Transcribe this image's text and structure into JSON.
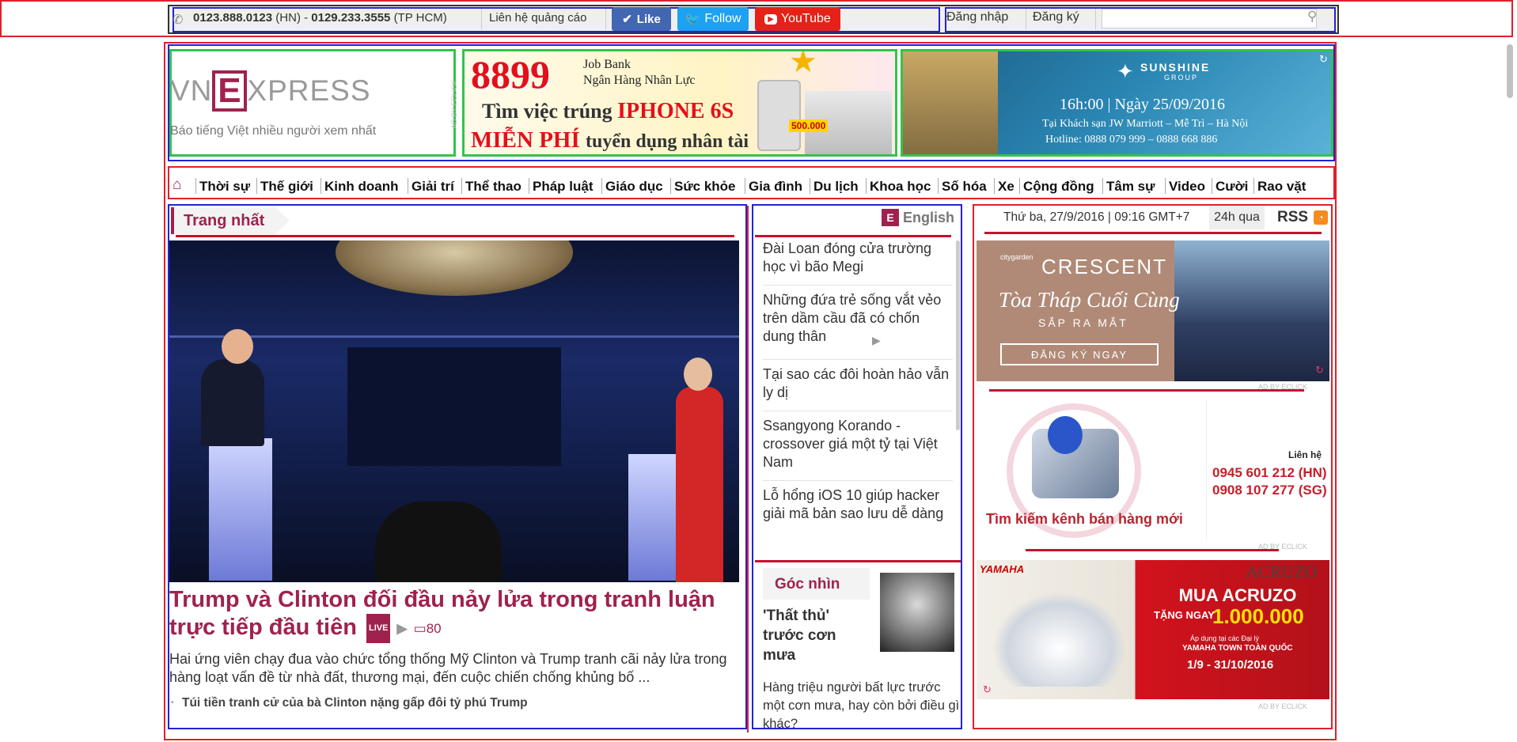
{
  "topbar": {
    "phone_hn": "0123.888.0123",
    "hn_label": "(HN) -",
    "phone_hcm": "0129.233.3555",
    "hcm_label": "(TP HCM)",
    "ads_contact": "Liên hệ quảng cáo",
    "like_label": "Like",
    "follow_label": "Follow",
    "youtube_label": "YouTube",
    "login": "Đăng nhập",
    "register": "Đăng ký",
    "search_placeholder": ""
  },
  "header": {
    "logo_vn": "VN",
    "logo_e": "E",
    "logo_xpress": "XPRESS",
    "tagline": "Báo tiếng Việt nhiều người xem nhất",
    "ad_label": "AD BY ECLICK",
    "ad_job": {
      "number": "8899",
      "brand1": "Job Bank",
      "brand2": "Ngân Hàng Nhân Lực",
      "line1a": "Tìm việc trúng",
      "line1b": "IPHONE 6S",
      "line2a": "MIỄN PHÍ",
      "line2b": "tuyển dụng nhân tài",
      "price": "500.000"
    },
    "ad_sun": {
      "brand": "SUNSHINE",
      "group": "GROUP",
      "time": "16h:00 | Ngày 25/09/2016",
      "place": "Tại Khách sạn JW Marriott – Mễ Trì – Hà Nội",
      "hotline": "Hotline: 0888 079 999 – 0888 668 886"
    }
  },
  "nav": [
    "Thời sự",
    "Thế giới",
    "Kinh doanh",
    "Giải trí",
    "Thể thao",
    "Pháp luật",
    "Giáo dục",
    "Sức khỏe",
    "Gia đình",
    "Du lịch",
    "Khoa học",
    "Số hóa",
    "Xe",
    "Cộng đồng",
    "Tâm sự",
    "Video",
    "Cười",
    "Rao vặt"
  ],
  "main": {
    "section_title": "Trang nhất",
    "headline": "Trump và Clinton đối đầu nảy lửa trong tranh luận trực tiếp đầu tiên",
    "live_badge": "LIVE",
    "comment_count": "80",
    "lead": "Hai ứng viên chạy đua vào chức tổng thống Mỹ Clinton và Trump tranh cãi nảy lửa trong hàng loạt vấn đề từ nhà đất, thương mại, đến cuộc chiến chống khủng bố ...",
    "related": "Túi tiền tranh cử của bà Clinton nặng gấp đôi tỷ phú Trump"
  },
  "mid": {
    "english_label": "English",
    "articles": [
      "Đài Loan đóng cửa trường học vì bão Megi",
      "Những đứa trẻ sống vắt vẻo trên dầm cầu đã có chốn dung thân",
      "Tại sao các đôi hoàn hảo vẫn ly dị",
      "Ssangyong Korando - crossover giá một tỷ tại Việt Nam",
      "Lỗ hổng iOS 10 giúp hacker giải mã bản sao lưu dễ dàng"
    ],
    "gocnhin_title": "Góc nhìn",
    "gocnhin_article": "'Thất thủ' trước cơn mưa",
    "gocnhin_lead": "Hàng triệu người bất lực trước một cơn mưa, hay còn bởi điều gì khác?"
  },
  "right": {
    "date": "Thứ ba, 27/9/2016 | 09:16 GMT+7",
    "btn_24h": "24h qua",
    "rss": "RSS",
    "ad_label": "AD BY ECLICK",
    "ad_crescent": {
      "brand_small": "citygarden",
      "brand": "CRESCENT",
      "title": "Tòa Tháp Cuối Cùng",
      "subtitle": "SẮP RA MẮT",
      "cta": "ĐĂNG KÝ NGAY"
    },
    "ad_shop": {
      "contact": "Liên hệ",
      "phone_hn": "0945 601 212 (HN)",
      "phone_sg": "0908 107 277 (SG)",
      "slogan": "Tìm kiếm kênh bán hàng mới"
    },
    "ad_yamaha": {
      "brand": "YAMAHA",
      "model": "ACRUZO",
      "headline": "MUA ACRUZO",
      "gift_label": "TẶNG NGAY",
      "gift_amount": "1.000.000",
      "note": "Áp dụng tại các Đại lý",
      "note2": "YAMAHA TOWN TOÀN QUỐC",
      "dates": "1/9 - 31/10/2016"
    }
  },
  "colors": {
    "brand": "#9f224e",
    "frame_red": "#e0202a",
    "frame_blue": "#2222d8",
    "frame_green": "#35c24a"
  }
}
